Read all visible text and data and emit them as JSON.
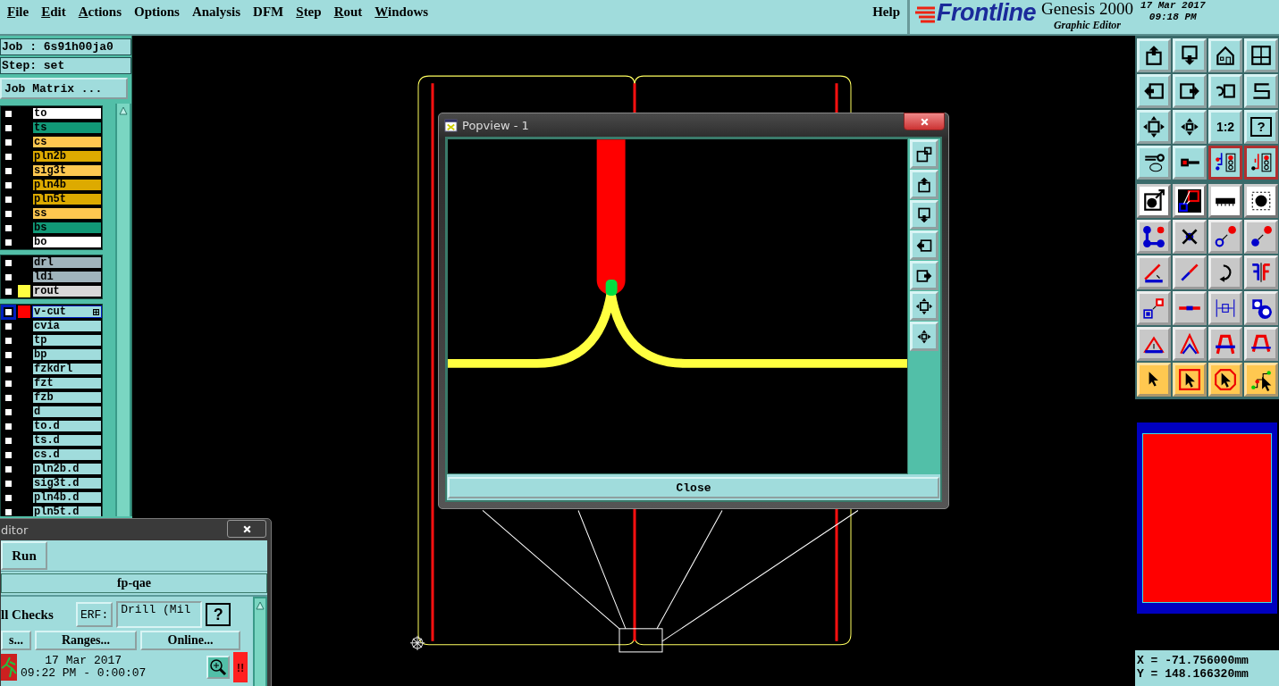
{
  "menu_bar": {
    "items": [
      {
        "label": "File",
        "underlined": true
      },
      {
        "label": "Edit",
        "underlined": true
      },
      {
        "label": "Actions",
        "underlined": true
      },
      {
        "label": "Options",
        "underlined": false
      },
      {
        "label": "Analysis",
        "underlined": false
      },
      {
        "label": "DFM",
        "underlined": false
      },
      {
        "label": "Step",
        "underlined": true
      },
      {
        "label": "Rout",
        "underlined": true
      },
      {
        "label": "Windows",
        "underlined": true
      }
    ],
    "help": "Help"
  },
  "branding": {
    "logo": "Frontline",
    "product": "Genesis 2000",
    "subtitle": "Graphic Editor",
    "date": "17 Mar 2017",
    "time": "09:18 PM"
  },
  "job_panel": {
    "job": "Job : 6s91h00ja0",
    "step": "Step: set",
    "matrix_button": "Job Matrix ...",
    "layer_groups": [
      {
        "layers": [
          {
            "name": "to",
            "color": "#ffffff",
            "checked": false,
            "selected": false
          },
          {
            "name": "ts",
            "color": "#119977",
            "checked": false,
            "selected": false
          },
          {
            "name": "cs",
            "color": "#ffc850",
            "checked": false,
            "selected": false
          },
          {
            "name": "pln2b",
            "color": "#ddaa00",
            "checked": false,
            "selected": false
          },
          {
            "name": "sig3t",
            "color": "#ffc850",
            "checked": false,
            "selected": false
          },
          {
            "name": "pln4b",
            "color": "#ddaa00",
            "checked": false,
            "selected": false
          },
          {
            "name": "pln5t",
            "color": "#ddaa00",
            "checked": false,
            "selected": false
          },
          {
            "name": "ss",
            "color": "#ffc850",
            "checked": false,
            "selected": false
          },
          {
            "name": "bs",
            "color": "#119977",
            "checked": false,
            "selected": false
          },
          {
            "name": "bo",
            "color": "#ffffff",
            "checked": false,
            "selected": false
          }
        ]
      },
      {
        "layers": [
          {
            "name": "drl",
            "color": "#a0b4bc",
            "checked": false,
            "selected": false
          },
          {
            "name": "ldi",
            "color": "#a0b4bc",
            "checked": false,
            "selected": false
          },
          {
            "name": "rout",
            "color": "#d8d8d8",
            "swatch": {
              "color": "#ffff40"
            },
            "checked": false,
            "selected": false
          }
        ]
      },
      {
        "layers": [
          {
            "name": "v-cut",
            "color": "#a0dcdc",
            "swatch": {
              "color": "#ff0000"
            },
            "checked": false,
            "selected": true
          },
          {
            "name": "cvia",
            "color": "#a0dcdc",
            "checked": false,
            "selected": false
          },
          {
            "name": "tp",
            "color": "#a0dcdc",
            "checked": false,
            "selected": false
          },
          {
            "name": "bp",
            "color": "#a0dcdc",
            "checked": false,
            "selected": false
          },
          {
            "name": "fzkdrl",
            "color": "#a0dcdc",
            "checked": false,
            "selected": false
          },
          {
            "name": "fzt",
            "color": "#a0dcdc",
            "checked": false,
            "selected": false
          },
          {
            "name": "fzb",
            "color": "#a0dcdc",
            "checked": false,
            "selected": false
          },
          {
            "name": "d",
            "color": "#a0dcdc",
            "checked": false,
            "selected": false
          },
          {
            "name": "to.d",
            "color": "#a0dcdc",
            "checked": false,
            "selected": false
          },
          {
            "name": "ts.d",
            "color": "#a0dcdc",
            "checked": false,
            "selected": false
          },
          {
            "name": "cs.d",
            "color": "#a0dcdc",
            "checked": false,
            "selected": false
          },
          {
            "name": "pln2b.d",
            "color": "#a0dcdc",
            "checked": false,
            "selected": false
          },
          {
            "name": "sig3t.d",
            "color": "#a0dcdc",
            "checked": false,
            "selected": false
          },
          {
            "name": "pln4b.d",
            "color": "#a0dcdc",
            "checked": false,
            "selected": false
          },
          {
            "name": "pln5t.d",
            "color": "#a0dcdc",
            "checked": false,
            "selected": false
          }
        ]
      }
    ]
  },
  "popview": {
    "title": "Popview - 1",
    "close_button": "Close"
  },
  "toolbar": {
    "scale_button": "1:2",
    "help_button": "?"
  },
  "coordinates": {
    "x": "X = -71.756000mm",
    "y": "Y = 148.166320mm"
  },
  "checklist_window": {
    "title": "ditor",
    "run_button": "Run",
    "checklist_name": "fp-qae",
    "checks_label": "ll Checks",
    "erf_button": "ERF:",
    "erf_value": "Drill (Mil",
    "help_button": "?",
    "buttons": [
      "s...",
      "Ranges...",
      "Online..."
    ],
    "date": "17 Mar 2017",
    "time": "09:22 PM - 0:00:07",
    "alert": "!!"
  }
}
